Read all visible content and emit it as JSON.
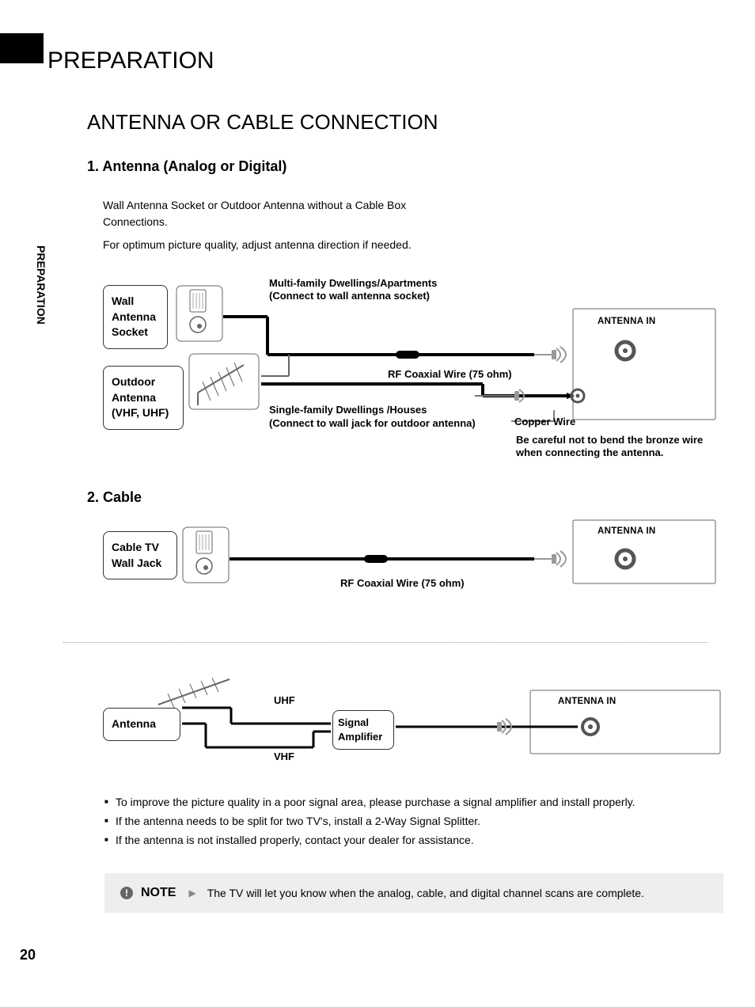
{
  "pageNumber": "20",
  "sideLabel": "PREPARATION",
  "pageTitle": "PREPARATION",
  "sectionTitle": "ANTENNA OR CABLE CONNECTION",
  "antennaSection": {
    "heading": "1. Antenna (Analog or Digital)",
    "body1": "Wall Antenna Socket or Outdoor Antenna without a Cable Box Connections.",
    "body2": "For optimum picture quality, adjust antenna direction if needed."
  },
  "diagram1": {
    "wallSocketLabel": "Wall\nAntenna\nSocket",
    "outdoorAntennaLabel": "Outdoor\nAntenna\n(VHF, UHF)",
    "multiFamily1": "Multi-family Dwellings/Apartments",
    "multiFamily2": "(Connect to wall antenna socket)",
    "rfCoaxLabel": "RF Coaxial Wire (75 ohm)",
    "singleFamily1": "Single-family Dwellings /Houses",
    "singleFamily2": "(Connect to wall jack for outdoor antenna)",
    "antennaIn": "ANTENNA IN",
    "copperWire": "Copper Wire",
    "warning1": "Be careful not to bend the bronze wire",
    "warning2": "when connecting the antenna."
  },
  "cableSection": {
    "heading": "2. Cable",
    "cableTvLabel": "Cable TV\nWall Jack",
    "rfCoaxLabel": "RF Coaxial Wire (75 ohm)",
    "antennaIn": "ANTENNA IN"
  },
  "diagram3": {
    "antennaLabel": "Antenna",
    "uhf": "UHF",
    "vhf": "VHF",
    "sigAmp": "Signal\nAmplifier",
    "antennaIn": "ANTENNA IN"
  },
  "bullets": {
    "b1": "To improve the picture quality in a poor signal area, please purchase a signal amplifier and install properly.",
    "b2": "If the antenna needs to be split for two TV's, install a 2-Way Signal Splitter.",
    "b3": "If the antenna is not installed properly, contact your dealer for assistance."
  },
  "note": {
    "label": "NOTE",
    "text": "The TV will let you know when the analog, cable, and digital channel scans are complete."
  }
}
